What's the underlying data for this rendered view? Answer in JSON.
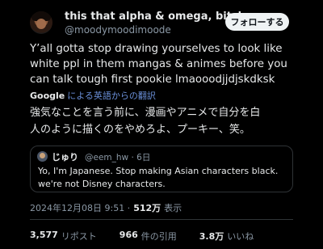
{
  "author": {
    "display_name": "this that alpha & omega, bitch",
    "handle": "@moodymoodimoode"
  },
  "follow_label": "フォローする",
  "tweet": {
    "text": "Y’all gotta stop drawing yourselves to look like\nwhite ppl in them mangas & animes before you\ncan talk tough first pookie lmaooodjjdjskdksk"
  },
  "translation": {
    "provider": "Google",
    "link_label": "による英語からの翻訳",
    "text": "強気なことを言う前に、漫画やアニメで自分を白\n人のように描くのをやめろよ、プーキー、笑。"
  },
  "quote": {
    "name": "じゅり",
    "meta": "@eem_hw · 6日",
    "text": "Yo, I'm Japanese. Stop making Asian characters black.\nwe're not Disney characters."
  },
  "meta": {
    "datetime": "2024年12月08日 9:51 ·",
    "views_count": "512万",
    "views_label": "表示"
  },
  "stats": {
    "reposts": {
      "count": "3,577",
      "label": "リポスト"
    },
    "quotes": {
      "count": "966",
      "label": "件の引用"
    },
    "likes": {
      "count": "3.8万",
      "label": "いいね"
    }
  }
}
